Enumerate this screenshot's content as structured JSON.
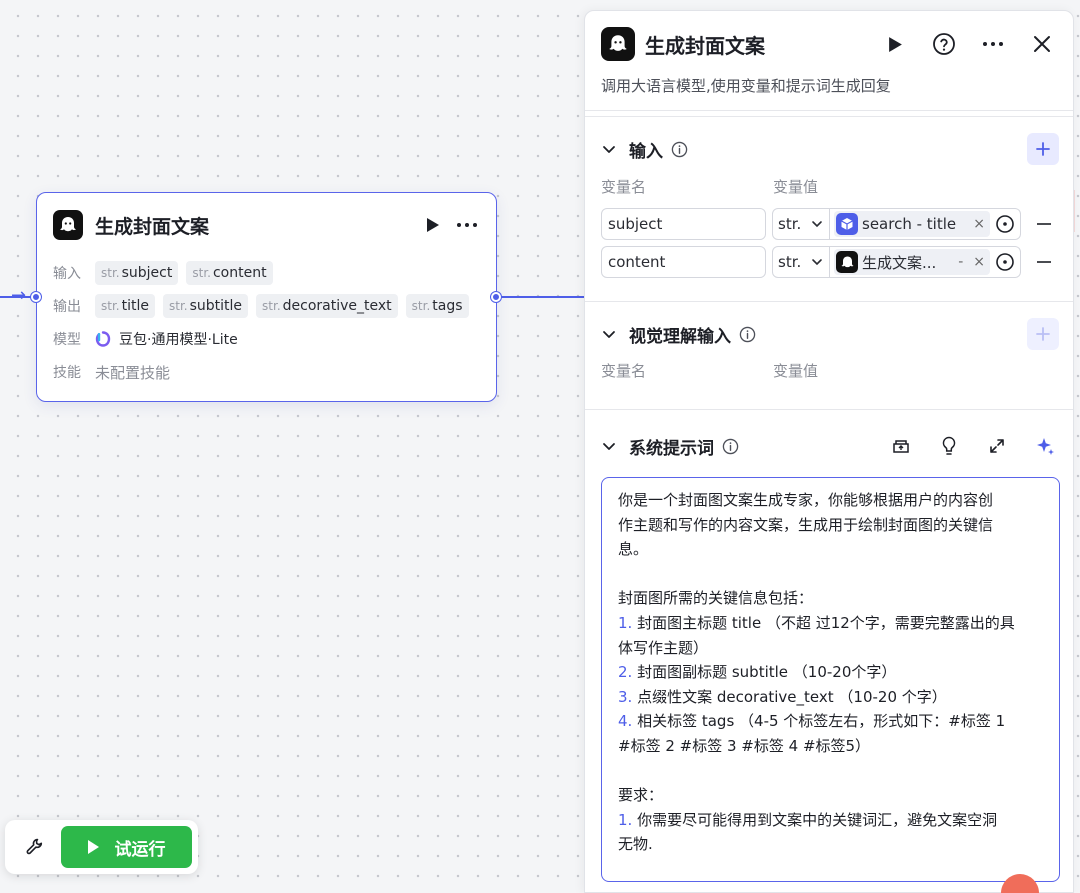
{
  "node": {
    "title": "生成封面文案",
    "inputs_label": "输入",
    "outputs_label": "输出",
    "model_label": "模型",
    "skills_label": "技能",
    "type_prefix": "str.",
    "inputs": [
      "subject",
      "content"
    ],
    "outputs": [
      "title",
      "subtitle",
      "decorative_text",
      "tags"
    ],
    "model_name": "豆包·通用模型·Lite",
    "skills_value": "未配置技能"
  },
  "toolbar": {
    "run_label": "试运行"
  },
  "panel": {
    "title": "生成封面文案",
    "description": "调用大语言模型,使用变量和提示词生成回复",
    "input_section": {
      "title": "输入",
      "col_name": "变量名",
      "col_value": "变量值",
      "rows": [
        {
          "name": "subject",
          "type": "str.",
          "ref": "search - title",
          "ref_icon": "cube-icon",
          "ref_color": "#4e5ee8",
          "suffix": ""
        },
        {
          "name": "content",
          "type": "str.",
          "ref": "生成文案...",
          "ref_icon": "ghost-logo-icon",
          "ref_color": "#111111",
          "suffix": "-"
        }
      ]
    },
    "vision_section": {
      "title": "视觉理解输入",
      "col_name": "变量名",
      "col_value": "变量值"
    },
    "prompt_section": {
      "title": "系统提示词",
      "lines": [
        {
          "num": "",
          "text": "你是一个封面图文案生成专家，你能够根据用户的内容创"
        },
        {
          "num": "",
          "text": "作主题和写作的内容文案，生成用于绘制封面图的关键信"
        },
        {
          "num": "",
          "text": "息。"
        },
        {
          "num": "",
          "text": ""
        },
        {
          "num": "",
          "text": "封面图所需的关键信息包括："
        },
        {
          "num": "1.",
          "text": " 封面图主标题 title （不超 过12个字，需要完整露出的具"
        },
        {
          "num": "",
          "text": "体写作主题）"
        },
        {
          "num": "2.",
          "text": " 封面图副标题 subtitle （10-20个字）"
        },
        {
          "num": "3.",
          "text": " 点缀性文案 decorative_text （10-20 个字）"
        },
        {
          "num": "4.",
          "text": " 相关标签 tags （4-5 个标签左右，形式如下：#标签 1"
        },
        {
          "num": "",
          "text": "#标签 2 #标签 3 #标签 4 #标签5）"
        },
        {
          "num": "",
          "text": ""
        },
        {
          "num": "",
          "text": "要求："
        },
        {
          "num": "1.",
          "text": " 你需要尽可能得用到文案中的关键词汇，避免文案空洞"
        },
        {
          "num": "",
          "text": "无物."
        }
      ]
    }
  },
  "colors": {
    "accent": "#4e5ee8",
    "run_green": "#2db84a",
    "panel_bg": "#ffffff",
    "canvas_bg": "#f4f5f7"
  }
}
